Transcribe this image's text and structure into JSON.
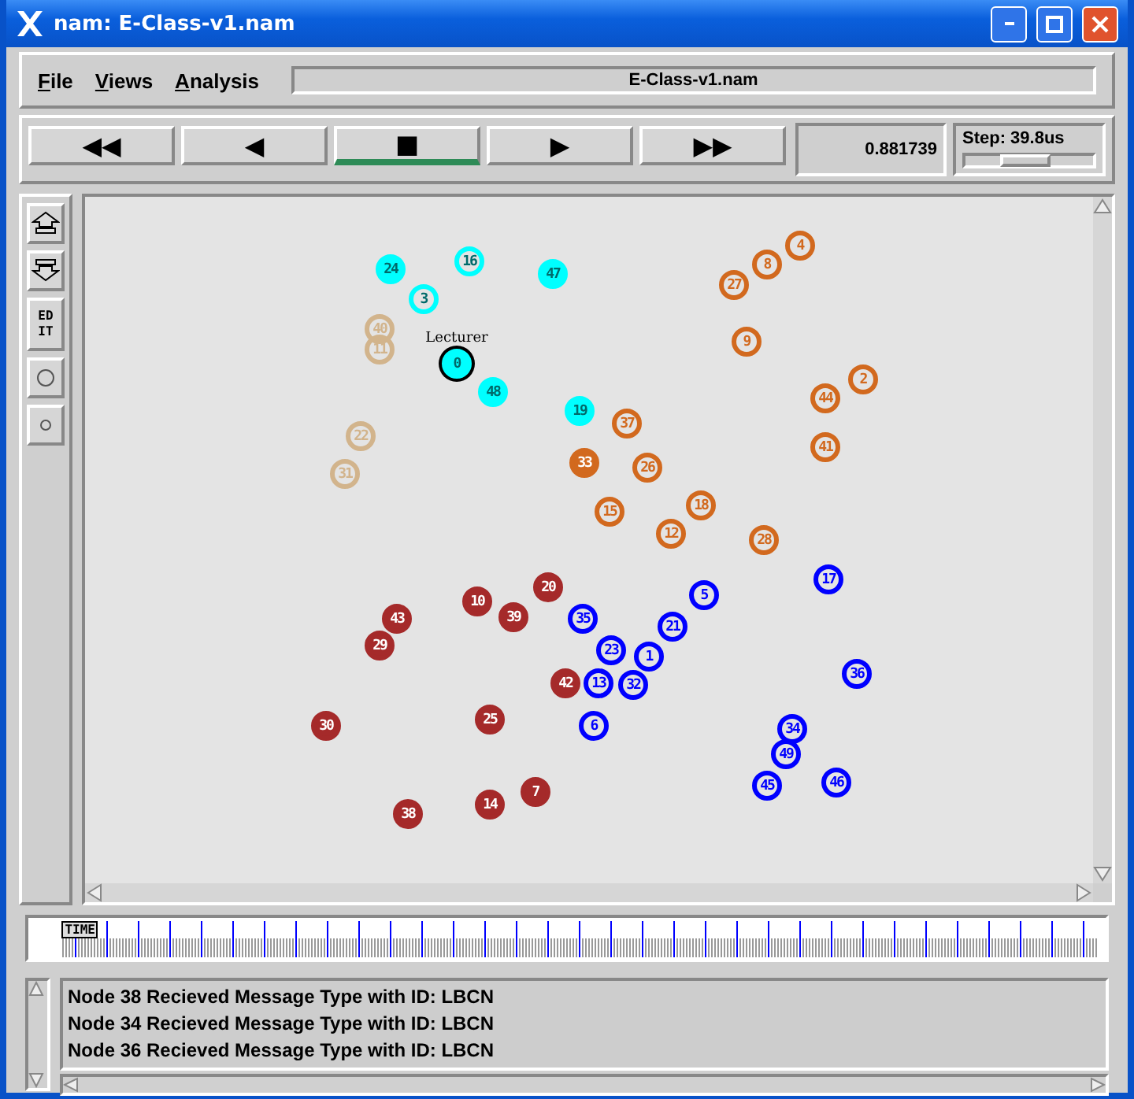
{
  "window": {
    "title": "nam: E-Class-v1.nam"
  },
  "menu": [
    {
      "label": "File"
    },
    {
      "label": "Views"
    },
    {
      "label": "Analysis"
    }
  ],
  "file_name": "E-Class-v1.nam",
  "controls": [
    {
      "symbol": "◀◀",
      "selected": false
    },
    {
      "symbol": "◀",
      "selected": false
    },
    {
      "symbol": "■",
      "selected": true
    },
    {
      "symbol": "▶",
      "selected": false
    },
    {
      "symbol": "▶▶",
      "selected": false
    }
  ],
  "current_time": "0.881739",
  "step": {
    "label": "Step: 39.8us",
    "level": 0.45
  },
  "tools": [
    {
      "kind": "zoom_in"
    },
    {
      "kind": "zoom_out"
    },
    {
      "kind": "text",
      "label": "EDIT"
    },
    {
      "kind": "big_circle"
    },
    {
      "kind": "small_circle"
    }
  ],
  "nodes": [
    {
      "label": "0",
      "color": "#00ffff",
      "filled": true,
      "selected": true,
      "caption": "Lecturer"
    },
    {
      "label": "24",
      "color": "#00ffff",
      "filled": true,
      "selected": false
    },
    {
      "label": "16",
      "color": "#00ffff",
      "filled": false,
      "selected": false
    },
    {
      "label": "47",
      "color": "#00ffff",
      "filled": true,
      "selected": false
    },
    {
      "label": "3",
      "color": "#00ffff",
      "filled": false,
      "selected": false
    },
    {
      "label": "48",
      "color": "#00ffff",
      "filled": true,
      "selected": false
    },
    {
      "label": "19",
      "color": "#00ffff",
      "filled": true,
      "selected": false
    },
    {
      "label": "40",
      "color": "#d2b48c",
      "filled": false,
      "selected": false
    },
    {
      "label": "11",
      "color": "#d2b48c",
      "filled": false,
      "selected": false
    },
    {
      "label": "22",
      "color": "#d2b48c",
      "filled": false,
      "selected": false
    },
    {
      "label": "31",
      "color": "#d2b48c",
      "filled": false,
      "selected": false
    },
    {
      "label": "4",
      "color": "#d2691e",
      "filled": false,
      "selected": false
    },
    {
      "label": "8",
      "color": "#d2691e",
      "filled": false,
      "selected": false
    },
    {
      "label": "27",
      "color": "#d2691e",
      "filled": false,
      "selected": false
    },
    {
      "label": "9",
      "color": "#d2691e",
      "filled": false,
      "selected": false
    },
    {
      "label": "2",
      "color": "#d2691e",
      "filled": false,
      "selected": false
    },
    {
      "label": "44",
      "color": "#d2691e",
      "filled": false,
      "selected": false
    },
    {
      "label": "41",
      "color": "#d2691e",
      "filled": false,
      "selected": false
    },
    {
      "label": "37",
      "color": "#d2691e",
      "filled": false,
      "selected": false
    },
    {
      "label": "33",
      "color": "#d2691e",
      "filled": true,
      "selected": false
    },
    {
      "label": "26",
      "color": "#d2691e",
      "filled": false,
      "selected": false
    },
    {
      "label": "15",
      "color": "#d2691e",
      "filled": false,
      "selected": false
    },
    {
      "label": "18",
      "color": "#d2691e",
      "filled": false,
      "selected": false
    },
    {
      "label": "12",
      "color": "#d2691e",
      "filled": false,
      "selected": false
    },
    {
      "label": "28",
      "color": "#d2691e",
      "filled": false,
      "selected": false
    },
    {
      "label": "20",
      "color": "#a52a2a",
      "filled": true,
      "selected": false
    },
    {
      "label": "10",
      "color": "#a52a2a",
      "filled": true,
      "selected": false
    },
    {
      "label": "43",
      "color": "#a52a2a",
      "filled": true,
      "selected": false
    },
    {
      "label": "39",
      "color": "#a52a2a",
      "filled": true,
      "selected": false
    },
    {
      "label": "29",
      "color": "#a52a2a",
      "filled": true,
      "selected": false
    },
    {
      "label": "42",
      "color": "#a52a2a",
      "filled": true,
      "selected": false
    },
    {
      "label": "30",
      "color": "#a52a2a",
      "filled": true,
      "selected": false
    },
    {
      "label": "25",
      "color": "#a52a2a",
      "filled": true,
      "selected": false
    },
    {
      "label": "7",
      "color": "#a52a2a",
      "filled": true,
      "selected": false
    },
    {
      "label": "14",
      "color": "#a52a2a",
      "filled": true,
      "selected": false
    },
    {
      "label": "38",
      "color": "#a52a2a",
      "filled": true,
      "selected": false
    },
    {
      "label": "17",
      "color": "#0000ff",
      "filled": false,
      "selected": false
    },
    {
      "label": "5",
      "color": "#0000ff",
      "filled": false,
      "selected": false
    },
    {
      "label": "35",
      "color": "#0000ff",
      "filled": false,
      "selected": false
    },
    {
      "label": "23",
      "color": "#0000ff",
      "filled": false,
      "selected": false
    },
    {
      "label": "21",
      "color": "#0000ff",
      "filled": false,
      "selected": false
    },
    {
      "label": "1",
      "color": "#0000ff",
      "filled": false,
      "selected": false
    },
    {
      "label": "13",
      "color": "#0000ff",
      "filled": false,
      "selected": false
    },
    {
      "label": "32",
      "color": "#0000ff",
      "filled": false,
      "selected": false
    },
    {
      "label": "36",
      "color": "#0000ff",
      "filled": false,
      "selected": false
    },
    {
      "label": "6",
      "color": "#0000ff",
      "filled": false,
      "selected": false
    },
    {
      "label": "34",
      "color": "#0000ff",
      "filled": false,
      "selected": false
    },
    {
      "label": "49",
      "color": "#0000ff",
      "filled": false,
      "selected": false
    },
    {
      "label": "45",
      "color": "#0000ff",
      "filled": false,
      "selected": false
    },
    {
      "label": "46",
      "color": "#0000ff",
      "filled": false,
      "selected": false
    }
  ],
  "timeline": {
    "marker": "TIME",
    "level": 0.02
  },
  "log": [
    "Node 38 Recieved Message Type with ID: LBCN",
    "Node 34 Recieved Message Type with ID: LBCN",
    "Node 36 Recieved Message Type with ID: LBCN"
  ]
}
